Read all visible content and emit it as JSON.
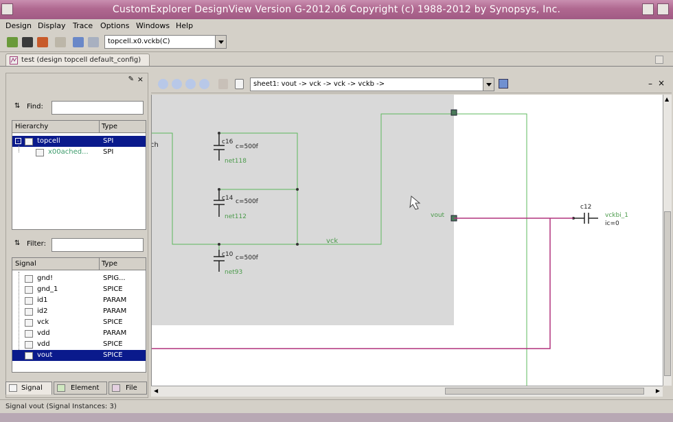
{
  "window": {
    "title": "CustomExplorer DesignView Version G-2012.06 Copyright (c) 1988-2012 by Synopsys, Inc."
  },
  "menu": [
    "Design",
    "Display",
    "Trace",
    "Options",
    "Windows",
    "Help"
  ],
  "toolbar": {
    "design_combo": "topcell.x0.vckb(C)"
  },
  "doc_tab": {
    "label": "test (design topcell default_config)"
  },
  "left_panel": {
    "find_label": "Find:",
    "filter_label": "Filter:",
    "hierarchy": {
      "col1": "Hierarchy",
      "col2": "Type",
      "rows": [
        {
          "name": "topcell",
          "type": "SPI"
        },
        {
          "name": "x00ached...",
          "type": "SPI"
        }
      ]
    },
    "signals": {
      "col1": "Signal",
      "col2": "Type",
      "rows": [
        {
          "name": "gnd!",
          "type": "SPIG..."
        },
        {
          "name": "gnd_1",
          "type": "SPICE"
        },
        {
          "name": "id1",
          "type": "PARAM"
        },
        {
          "name": "id2",
          "type": "PARAM"
        },
        {
          "name": "vck",
          "type": "SPICE"
        },
        {
          "name": "vdd",
          "type": "PARAM"
        },
        {
          "name": "vdd",
          "type": "SPICE"
        },
        {
          "name": "vout",
          "type": "SPICE"
        }
      ]
    },
    "tabs": [
      "Signal",
      "Element",
      "File"
    ]
  },
  "schematic": {
    "sheet_combo": "sheet1: vout -> vck -> vck -> vckb ->",
    "labels": {
      "ch": "ch",
      "c16": "c16",
      "c16_val": "c=500f",
      "net118": "net118",
      "c14": "c14",
      "c14_val": "c=500f",
      "net112": "net112",
      "c10": "c10",
      "c10_val": "c=500f",
      "net93": "net93",
      "vck": "vck",
      "vout": "vout",
      "c12": "c12",
      "c12_net": "vckbi_1",
      "c12_ic": "ic=0"
    }
  },
  "status": {
    "text": "Signal vout (Signal Instances: 3)"
  },
  "colors": {
    "title_bar": "#b06890",
    "selection": "#0a1a8c",
    "wire_green": "#5cb85c",
    "wire_magenta": "#b0307c",
    "block_fill": "#d9d9d9"
  }
}
